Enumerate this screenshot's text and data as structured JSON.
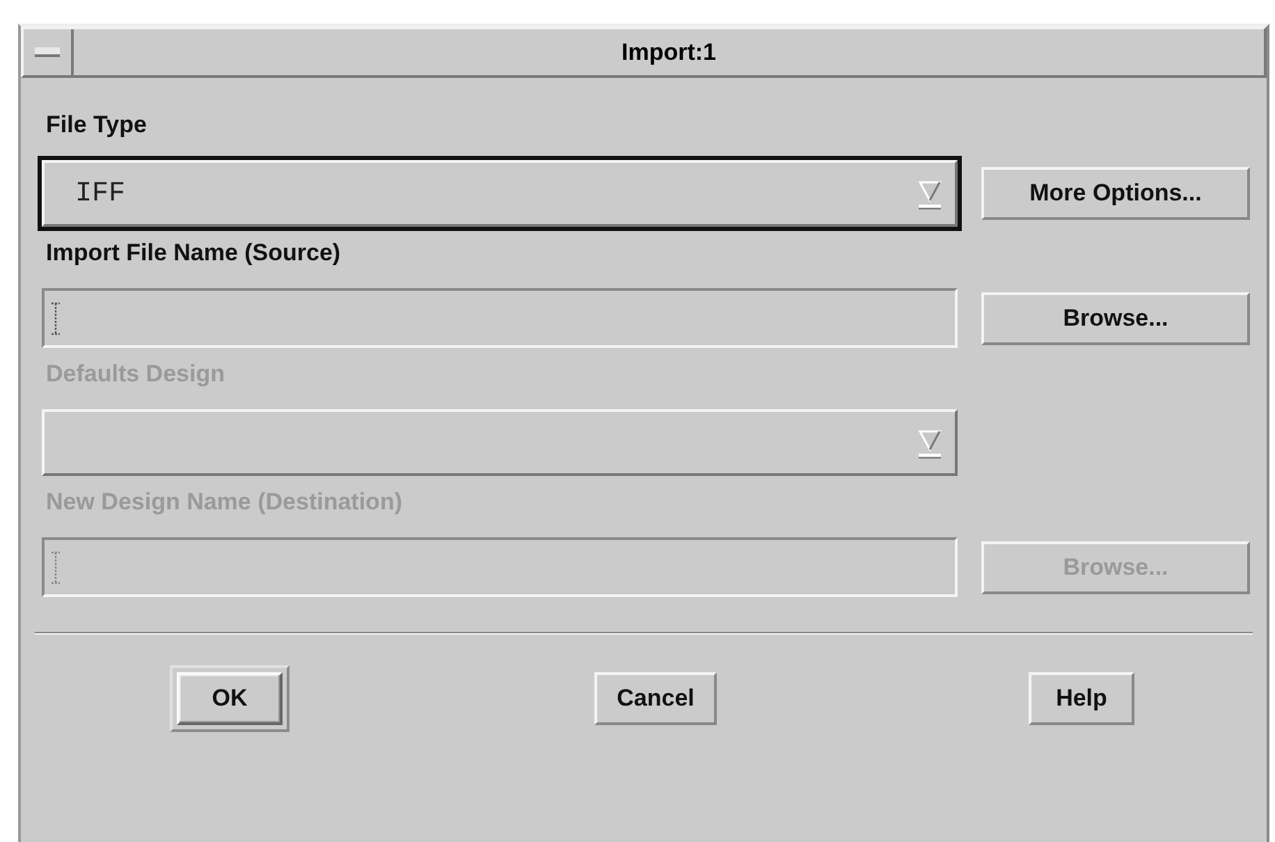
{
  "window": {
    "title": "Import:1"
  },
  "fields": [
    {
      "kind": "dropdown",
      "label": "File Type",
      "value": "IFF",
      "disabled": false,
      "focused": true,
      "button": "More Options..."
    },
    {
      "kind": "text",
      "label": "Import File Name (Source)",
      "disabled": false,
      "focused": false,
      "button": "Browse..."
    },
    {
      "kind": "dropdown",
      "label": "Defaults Design",
      "disabled": true,
      "focused": false
    },
    {
      "kind": "text",
      "label": "New Design Name (Destination)",
      "disabled": true,
      "focused": false,
      "button": "Browse..."
    }
  ],
  "buttons": [
    {
      "label": "OK",
      "default": true
    },
    {
      "label": "Cancel",
      "default": false
    },
    {
      "label": "Help",
      "default": false
    }
  ]
}
